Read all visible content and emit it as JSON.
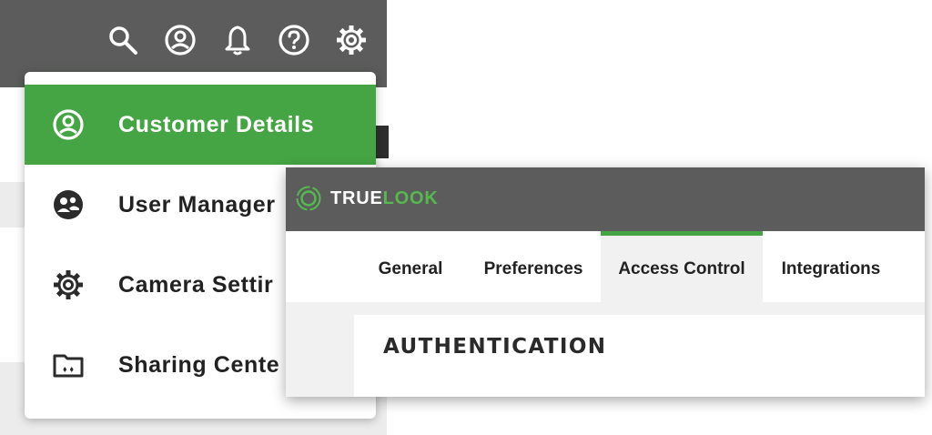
{
  "header_icons": [
    "search-icon",
    "account-icon",
    "bell-icon",
    "help-icon",
    "settings-icon"
  ],
  "menu": {
    "items": [
      {
        "label": "Customer Details",
        "icon": "account-circle-icon",
        "active": true
      },
      {
        "label": "User Manager",
        "icon": "users-icon",
        "active": false
      },
      {
        "label": "Camera Settir",
        "icon": "gear-icon",
        "active": false
      },
      {
        "label": "Sharing Cente",
        "icon": "shared-folder-icon",
        "active": false
      }
    ]
  },
  "app": {
    "brand_primary": "TRUE",
    "brand_secondary": "LOOK",
    "tabs": [
      {
        "label": "General",
        "active": false
      },
      {
        "label": "Preferences",
        "active": false
      },
      {
        "label": "Access Control",
        "active": true
      },
      {
        "label": "Integrations",
        "active": false
      }
    ],
    "section_heading": "AUTHENTICATION"
  },
  "colors": {
    "accent_green": "#45a443",
    "header_gray": "#5b5c5b",
    "brand_green": "#56b94f"
  }
}
